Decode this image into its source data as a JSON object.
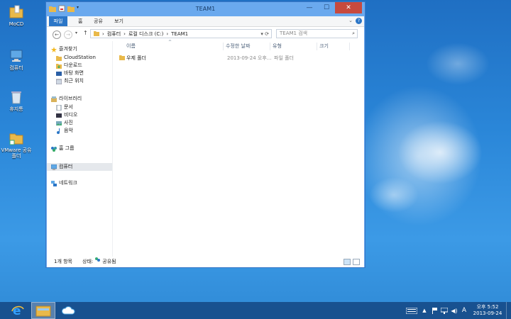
{
  "desktop": {
    "icons": [
      {
        "label": "MoCD",
        "icon": "folder-icon"
      },
      {
        "label": "컴퓨터",
        "icon": "computer-icon"
      },
      {
        "label": "휴지통",
        "icon": "recycle-bin-icon"
      },
      {
        "label": "VMware 공유 폴더",
        "icon": "shared-folder-icon"
      }
    ]
  },
  "window": {
    "title": "TEAM1",
    "ribbon_tabs": [
      "파일",
      "홈",
      "공유",
      "보기"
    ],
    "address": {
      "crumbs": [
        "컴퓨터",
        "로컬 디스크 (C:)",
        "TEAM1"
      ]
    },
    "search": {
      "placeholder": "TEAM1 검색"
    },
    "nav": {
      "favorites": "즐겨찾기",
      "favorite_items": [
        "CloudStation",
        "다운로드",
        "바탕 화면",
        "최근 위치"
      ],
      "libraries": "라이브러리",
      "library_items": [
        "문서",
        "비디오",
        "사진",
        "음악"
      ],
      "homegroup": "홈 그룹",
      "computer": "컴퓨터",
      "network": "네트워크"
    },
    "columns": [
      "이름",
      "수정한 날짜",
      "유형",
      "크기"
    ],
    "files": [
      {
        "name": "우제 폴더",
        "modified": "2013-09-24 오후...",
        "type": "파일 폴더",
        "size": ""
      }
    ],
    "status": {
      "count": "1개 항목",
      "state_label": "상태:",
      "state_value": "공유됨"
    }
  },
  "taskbar": {
    "items": [
      "internet-explorer-icon",
      "file-explorer-icon",
      "cloud-station-icon"
    ],
    "tray": {
      "ime": "A",
      "time": "오후 5:52",
      "date": "2013-09-24"
    }
  },
  "colors": {
    "accent": "#2b76c7",
    "close": "#c74a3e",
    "desktop": "#2a86d8"
  }
}
